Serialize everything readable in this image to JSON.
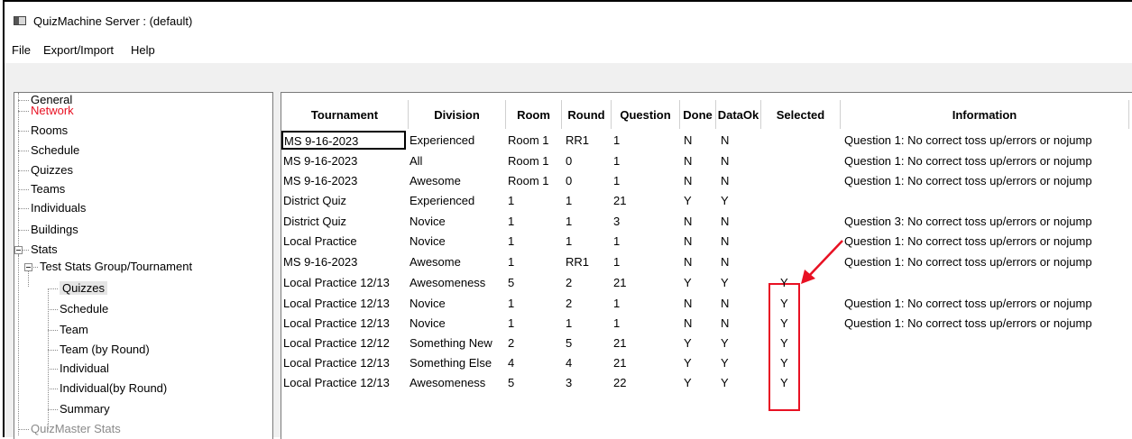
{
  "window": {
    "title": "QuizMachine Server : (default)"
  },
  "menu": [
    "File",
    "Export/Import",
    "Help"
  ],
  "tree": {
    "items": [
      {
        "label": "General",
        "level": 0,
        "color": "normal"
      },
      {
        "label": "Network",
        "level": 0,
        "color": "red"
      },
      {
        "label": "Rooms",
        "level": 0,
        "color": "normal"
      },
      {
        "label": "Schedule",
        "level": 0,
        "color": "normal"
      },
      {
        "label": "Quizzes",
        "level": 0,
        "color": "normal"
      },
      {
        "label": "Teams",
        "level": 0,
        "color": "normal"
      },
      {
        "label": "Individuals",
        "level": 0,
        "color": "normal"
      },
      {
        "label": "Buildings",
        "level": 0,
        "color": "normal"
      },
      {
        "label": "Stats",
        "level": 0,
        "color": "normal",
        "expanded": true
      },
      {
        "label": "Test Stats Group/Tournament",
        "level": 1,
        "color": "normal",
        "expanded": true
      },
      {
        "label": "Quizzes",
        "level": 2,
        "color": "normal",
        "selected": true
      },
      {
        "label": "Schedule",
        "level": 2,
        "color": "normal"
      },
      {
        "label": "Team",
        "level": 2,
        "color": "normal"
      },
      {
        "label": "Team (by Round)",
        "level": 2,
        "color": "normal"
      },
      {
        "label": "Individual",
        "level": 2,
        "color": "normal"
      },
      {
        "label": "Individual(by Round)",
        "level": 2,
        "color": "normal"
      },
      {
        "label": "Summary",
        "level": 2,
        "color": "normal"
      },
      {
        "label": "QuizMaster Stats",
        "level": 0,
        "color": "grey"
      }
    ]
  },
  "table": {
    "columns": [
      "Tournament",
      "Division",
      "Room",
      "Round",
      "Question",
      "Done",
      "DataOk",
      "Selected",
      "Information"
    ],
    "rows": [
      [
        "MS 9-16-2023",
        "Experienced",
        "Room 1",
        "RR1",
        "1",
        "N",
        "N",
        "",
        "Question 1: No correct toss up/errors or nojump"
      ],
      [
        "MS 9-16-2023",
        "All",
        "Room 1",
        "0",
        "1",
        "N",
        "N",
        "",
        "Question 1: No correct toss up/errors or nojump"
      ],
      [
        "MS 9-16-2023",
        "Awesome",
        "Room 1",
        "0",
        "1",
        "N",
        "N",
        "",
        "Question 1: No correct toss up/errors or nojump"
      ],
      [
        "District Quiz",
        "Experienced",
        "1",
        "1",
        "21",
        "Y",
        "Y",
        "",
        ""
      ],
      [
        "District Quiz",
        "Novice",
        "1",
        "1",
        "3",
        "N",
        "N",
        "",
        "Question 3: No correct toss up/errors or nojump"
      ],
      [
        "Local Practice",
        "Novice",
        "1",
        "1",
        "1",
        "N",
        "N",
        "",
        "Question 1: No correct toss up/errors or nojump"
      ],
      [
        "MS 9-16-2023",
        "Awesome",
        "1",
        "RR1",
        "1",
        "N",
        "N",
        "",
        "Question 1: No correct toss up/errors or nojump"
      ],
      [
        "Local Practice 12/13",
        "Awesomeness",
        "5",
        "2",
        "21",
        "Y",
        "Y",
        "Y",
        ""
      ],
      [
        "Local Practice 12/13",
        "Novice",
        "1",
        "2",
        "1",
        "N",
        "N",
        "Y",
        "Question 1: No correct toss up/errors or nojump"
      ],
      [
        "Local Practice 12/13",
        "Novice",
        "1",
        "1",
        "1",
        "N",
        "N",
        "Y",
        "Question 1: No correct toss up/errors or nojump"
      ],
      [
        "Local Practice 12/12",
        "Something New",
        "2",
        "5",
        "21",
        "Y",
        "Y",
        "Y",
        ""
      ],
      [
        "Local Practice 12/13",
        "Something Else",
        "4",
        "4",
        "21",
        "Y",
        "Y",
        "Y",
        ""
      ],
      [
        "Local Practice 12/13",
        "Awesomeness",
        "5",
        "3",
        "22",
        "Y",
        "Y",
        "Y",
        ""
      ]
    ]
  },
  "annotation": {
    "color": "#e81123"
  }
}
